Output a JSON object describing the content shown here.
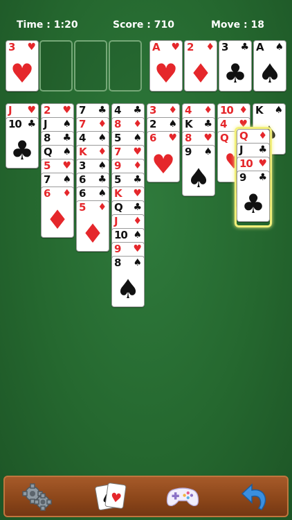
{
  "header": {
    "time": "Time : 1:20",
    "score": "Score : 710",
    "moves": "Move : 18"
  },
  "free_cells": [
    {
      "rank": "3",
      "suit": "♥",
      "color": "red"
    },
    null,
    null,
    null
  ],
  "foundations": [
    {
      "rank": "A",
      "suit": "♥",
      "color": "red"
    },
    {
      "rank": "2",
      "suit": "♦",
      "color": "red"
    },
    {
      "rank": "3",
      "suit": "♣",
      "color": "black"
    },
    {
      "rank": "A",
      "suit": "♠",
      "color": "black"
    }
  ],
  "tableau": [
    [
      {
        "rank": "J",
        "suit": "♥",
        "color": "red"
      },
      {
        "rank": "10",
        "suit": "♣",
        "color": "black"
      }
    ],
    [
      {
        "rank": "2",
        "suit": "♥",
        "color": "red"
      },
      {
        "rank": "J",
        "suit": "♠",
        "color": "black"
      },
      {
        "rank": "8",
        "suit": "♣",
        "color": "black"
      },
      {
        "rank": "Q",
        "suit": "♠",
        "color": "black"
      },
      {
        "rank": "5",
        "suit": "♥",
        "color": "red"
      },
      {
        "rank": "7",
        "suit": "♠",
        "color": "black"
      },
      {
        "rank": "6",
        "suit": "♦",
        "color": "red"
      }
    ],
    [
      {
        "rank": "7",
        "suit": "♣",
        "color": "black"
      },
      {
        "rank": "7",
        "suit": "♦",
        "color": "red"
      },
      {
        "rank": "4",
        "suit": "♠",
        "color": "black"
      },
      {
        "rank": "K",
        "suit": "♦",
        "color": "red"
      },
      {
        "rank": "3",
        "suit": "♠",
        "color": "black"
      },
      {
        "rank": "6",
        "suit": "♣",
        "color": "black"
      },
      {
        "rank": "6",
        "suit": "♠",
        "color": "black"
      },
      {
        "rank": "5",
        "suit": "♦",
        "color": "red"
      }
    ],
    [
      {
        "rank": "4",
        "suit": "♣",
        "color": "black"
      },
      {
        "rank": "8",
        "suit": "♦",
        "color": "red"
      },
      {
        "rank": "5",
        "suit": "♠",
        "color": "black"
      },
      {
        "rank": "7",
        "suit": "♥",
        "color": "red"
      },
      {
        "rank": "9",
        "suit": "♦",
        "color": "red"
      },
      {
        "rank": "5",
        "suit": "♣",
        "color": "black"
      },
      {
        "rank": "K",
        "suit": "♥",
        "color": "red"
      },
      {
        "rank": "Q",
        "suit": "♣",
        "color": "black"
      },
      {
        "rank": "J",
        "suit": "♦",
        "color": "red"
      },
      {
        "rank": "10",
        "suit": "♠",
        "color": "black"
      },
      {
        "rank": "9",
        "suit": "♥",
        "color": "red"
      },
      {
        "rank": "8",
        "suit": "♠",
        "color": "black"
      }
    ],
    [
      {
        "rank": "3",
        "suit": "♦",
        "color": "red"
      },
      {
        "rank": "2",
        "suit": "♠",
        "color": "black"
      },
      {
        "rank": "6",
        "suit": "♥",
        "color": "red"
      }
    ],
    [
      {
        "rank": "4",
        "suit": "♦",
        "color": "red"
      },
      {
        "rank": "K",
        "suit": "♣",
        "color": "black"
      },
      {
        "rank": "8",
        "suit": "♥",
        "color": "red"
      },
      {
        "rank": "9",
        "suit": "♠",
        "color": "black"
      }
    ],
    [
      {
        "rank": "10",
        "suit": "♦",
        "color": "red"
      },
      {
        "rank": "4",
        "suit": "♥",
        "color": "red"
      },
      {
        "rank": "Q",
        "suit": "♥",
        "color": "red",
        "face": true
      }
    ],
    [
      {
        "rank": "K",
        "suit": "♠",
        "color": "black",
        "face": true
      }
    ]
  ],
  "selected_stack": [
    {
      "rank": "Q",
      "suit": "♦",
      "color": "red"
    },
    {
      "rank": "J",
      "suit": "♣",
      "color": "black"
    },
    {
      "rank": "10",
      "suit": "♥",
      "color": "red"
    },
    {
      "rank": "9",
      "suit": "♣",
      "color": "black"
    }
  ],
  "toolbar": {
    "items": [
      {
        "name": "settings",
        "icon": "gears-icon"
      },
      {
        "name": "new-game",
        "icon": "cards-icon"
      },
      {
        "name": "more-games",
        "icon": "gamepad-icon"
      },
      {
        "name": "undo",
        "icon": "undo-arrow-icon"
      }
    ]
  },
  "colors": {
    "felt": "#2a6f34",
    "suit_red": "#e5272b",
    "suit_black": "#111111",
    "toolbar": "#8a4519",
    "highlight": "#f3f07a"
  }
}
